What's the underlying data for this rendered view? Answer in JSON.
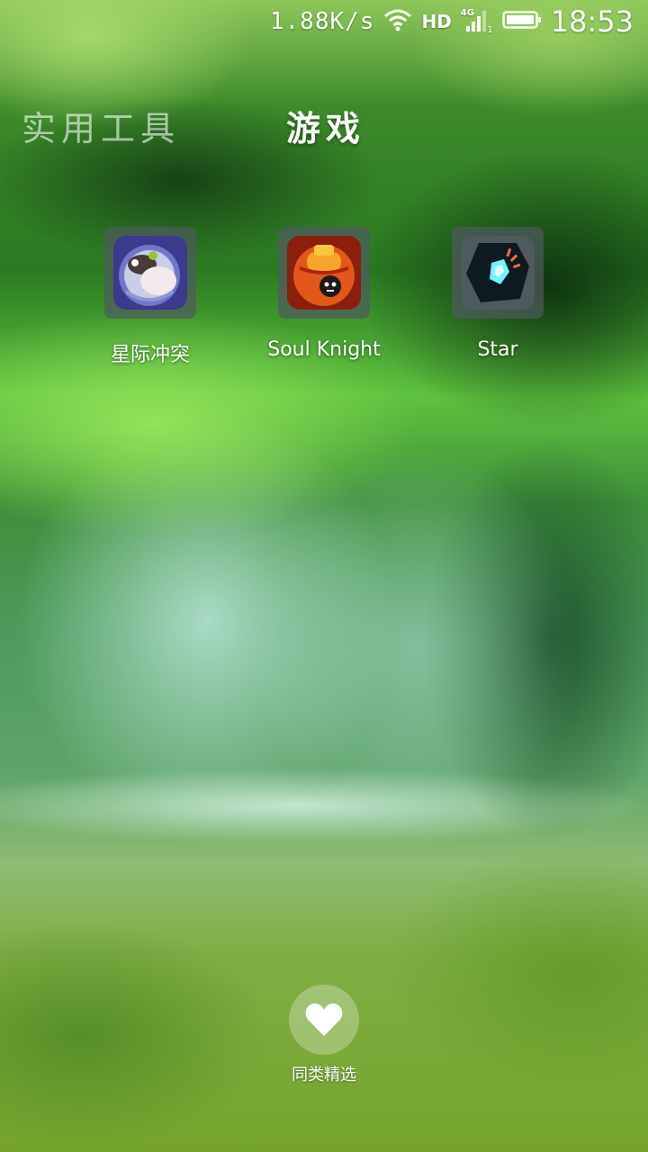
{
  "status_bar": {
    "net_speed": "1.88K/s",
    "network_type": "4G",
    "hd_label": "HD",
    "sim_slot": "1",
    "time": "18:53",
    "icons": [
      "wifi-icon",
      "signal-icon",
      "battery-icon"
    ]
  },
  "folder_tabs": [
    {
      "label": "实用工具",
      "active": false
    },
    {
      "label": "游戏",
      "active": true
    }
  ],
  "apps": [
    {
      "label": "星际冲突",
      "icon": "star-conflict-app-icon"
    },
    {
      "label": "Soul Knight",
      "icon": "soul-knight-app-icon"
    },
    {
      "label": "Star",
      "icon": "star-app-icon"
    }
  ],
  "similar_picks": {
    "label": "同类精选",
    "icon": "heart-icon"
  }
}
